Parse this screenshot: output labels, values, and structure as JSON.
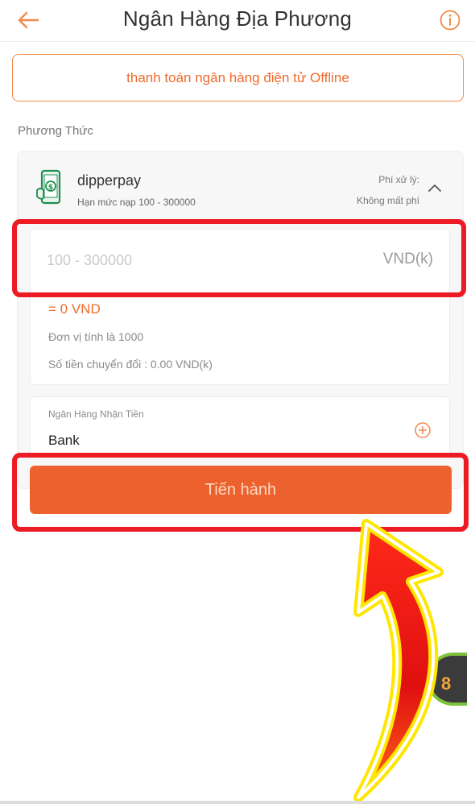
{
  "header": {
    "title": "Ngân Hàng Địa Phương",
    "back_icon": "arrow-left-icon",
    "info_icon": "info-icon"
  },
  "offline_button": {
    "label": "thanh toán ngân hàng điện tử Offline"
  },
  "section": {
    "label": "Phương Thức"
  },
  "method": {
    "name": "dipperpay",
    "limit": "Hạn mức nạp 100 - 300000",
    "fee_label": "Phí xử lý:",
    "fee_value": "Không mất phí",
    "icon": "mobile-payment-icon"
  },
  "amount": {
    "placeholder": "100 - 300000",
    "currency": "VND(k)",
    "converted": "= 0 VND",
    "unit_note": "Đơn vị tính là 1000",
    "convert_note": "Số tiền chuyển đổi : 0.00 VND(k)"
  },
  "bank": {
    "label": "Ngân Hàng Nhận Tiền",
    "value": "Bank",
    "add_icon": "plus-circle-icon"
  },
  "proceed_button": {
    "label": "Tiến hành"
  },
  "float_badge": {
    "text": "8"
  },
  "colors": {
    "accent": "#ec612d",
    "accent_text": "#ef6a2b",
    "highlight": "#ed1c24",
    "card_bg": "#f7f7f8"
  }
}
